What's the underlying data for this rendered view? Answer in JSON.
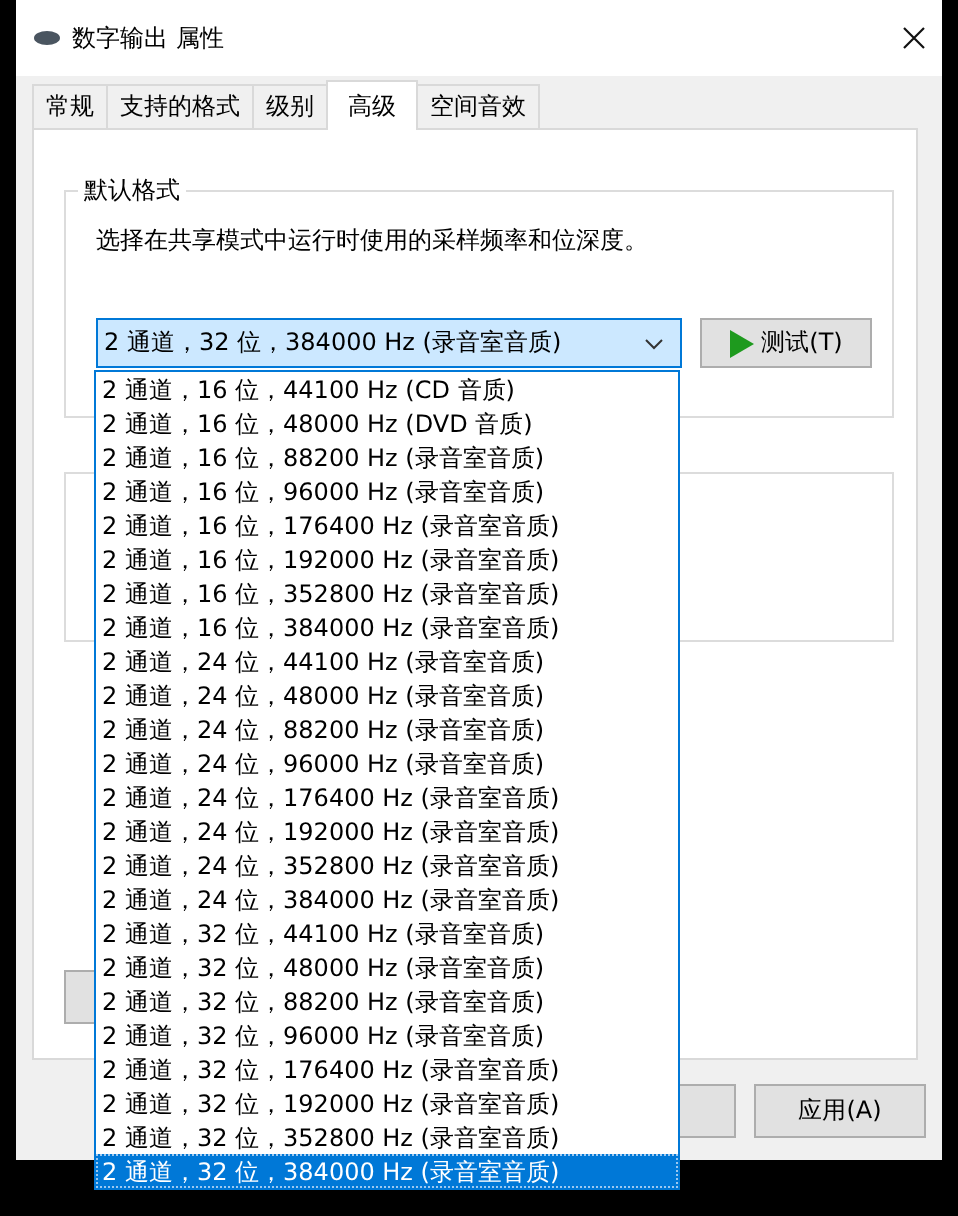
{
  "window": {
    "title": "数字输出 属性"
  },
  "tabs": [
    {
      "label": "常规",
      "selected": false
    },
    {
      "label": "支持的格式",
      "selected": false
    },
    {
      "label": "级别",
      "selected": false
    },
    {
      "label": "高级",
      "selected": true
    },
    {
      "label": "空间音效",
      "selected": false
    }
  ],
  "default_format": {
    "title": "默认格式",
    "description": "选择在共享模式中运行时使用的采样频率和位深度。",
    "combo": {
      "value": "2 通道，32 位，384000 Hz (录音室音质)",
      "expanded": true
    },
    "test_button": "测试(T)"
  },
  "dropdown_options": [
    {
      "label": "2 通道，16 位，44100 Hz (CD 音质)",
      "selected": false
    },
    {
      "label": "2 通道，16 位，48000 Hz (DVD 音质)",
      "selected": false
    },
    {
      "label": "2 通道，16 位，88200 Hz (录音室音质)",
      "selected": false
    },
    {
      "label": "2 通道，16 位，96000 Hz (录音室音质)",
      "selected": false
    },
    {
      "label": "2 通道，16 位，176400 Hz (录音室音质)",
      "selected": false
    },
    {
      "label": "2 通道，16 位，192000 Hz (录音室音质)",
      "selected": false
    },
    {
      "label": "2 通道，16 位，352800 Hz (录音室音质)",
      "selected": false
    },
    {
      "label": "2 通道，16 位，384000 Hz (录音室音质)",
      "selected": false
    },
    {
      "label": "2 通道，24 位，44100 Hz (录音室音质)",
      "selected": false
    },
    {
      "label": "2 通道，24 位，48000 Hz (录音室音质)",
      "selected": false
    },
    {
      "label": "2 通道，24 位，88200 Hz (录音室音质)",
      "selected": false
    },
    {
      "label": "2 通道，24 位，96000 Hz (录音室音质)",
      "selected": false
    },
    {
      "label": "2 通道，24 位，176400 Hz (录音室音质)",
      "selected": false
    },
    {
      "label": "2 通道，24 位，192000 Hz (录音室音质)",
      "selected": false
    },
    {
      "label": "2 通道，24 位，352800 Hz (录音室音质)",
      "selected": false
    },
    {
      "label": "2 通道，24 位，384000 Hz (录音室音质)",
      "selected": false
    },
    {
      "label": "2 通道，32 位，44100 Hz (录音室音质)",
      "selected": false
    },
    {
      "label": "2 通道，32 位，48000 Hz (录音室音质)",
      "selected": false
    },
    {
      "label": "2 通道，32 位，88200 Hz (录音室音质)",
      "selected": false
    },
    {
      "label": "2 通道，32 位，96000 Hz (录音室音质)",
      "selected": false
    },
    {
      "label": "2 通道，32 位，176400 Hz (录音室音质)",
      "selected": false
    },
    {
      "label": "2 通道，32 位，192000 Hz (录音室音质)",
      "selected": false
    },
    {
      "label": "2 通道，32 位，352800 Hz (录音室音质)",
      "selected": false
    },
    {
      "label": "2 通道，32 位，384000 Hz (录音室音质)",
      "selected": true
    }
  ],
  "buttons": [
    {
      "label": "应用(A)"
    }
  ]
}
